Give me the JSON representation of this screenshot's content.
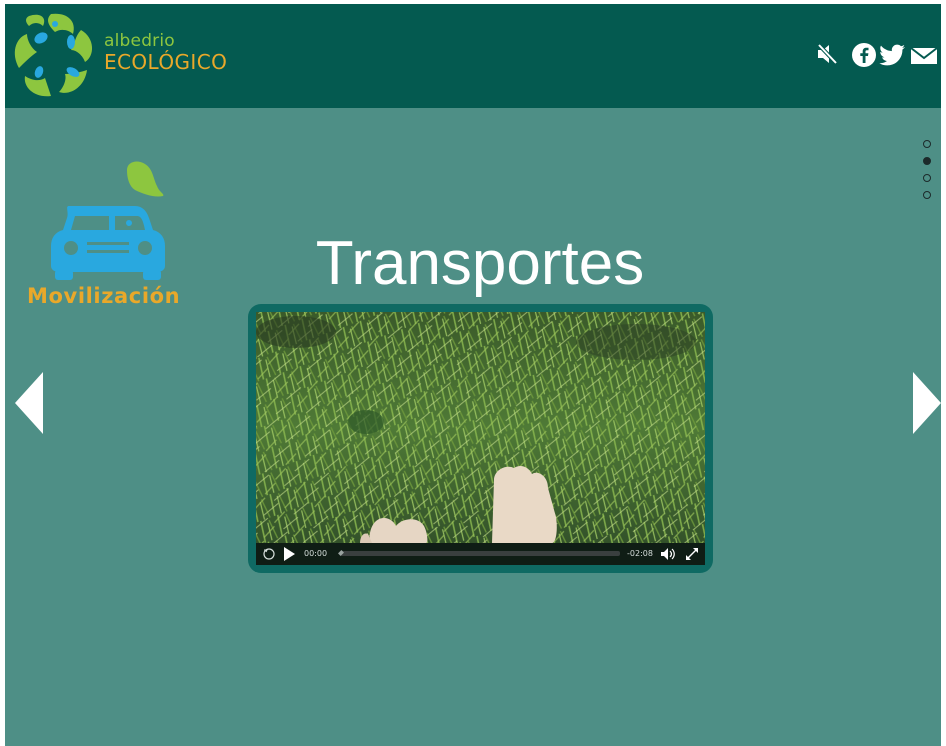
{
  "brand": {
    "line1": "albedrio",
    "line2": "ECOLÓGICO",
    "colors": {
      "green": "#8dc63f",
      "orange": "#e9a82a",
      "blue": "#29a8df",
      "header": "#045a50",
      "background": "#4e8f86"
    }
  },
  "header_icons": [
    "mute-icon",
    "facebook-icon",
    "twitter-icon",
    "mail-icon"
  ],
  "pager": {
    "total": 4,
    "active_index": 1
  },
  "category": {
    "label": "Movilización",
    "icon": "car-icon"
  },
  "page": {
    "title": "Transportes"
  },
  "video": {
    "current_time": "00:00",
    "remaining_time": "-02:08",
    "progress": 0.0
  },
  "navigation": {
    "prev_icon": "arrow-left-icon",
    "next_icon": "arrow-right-icon"
  }
}
